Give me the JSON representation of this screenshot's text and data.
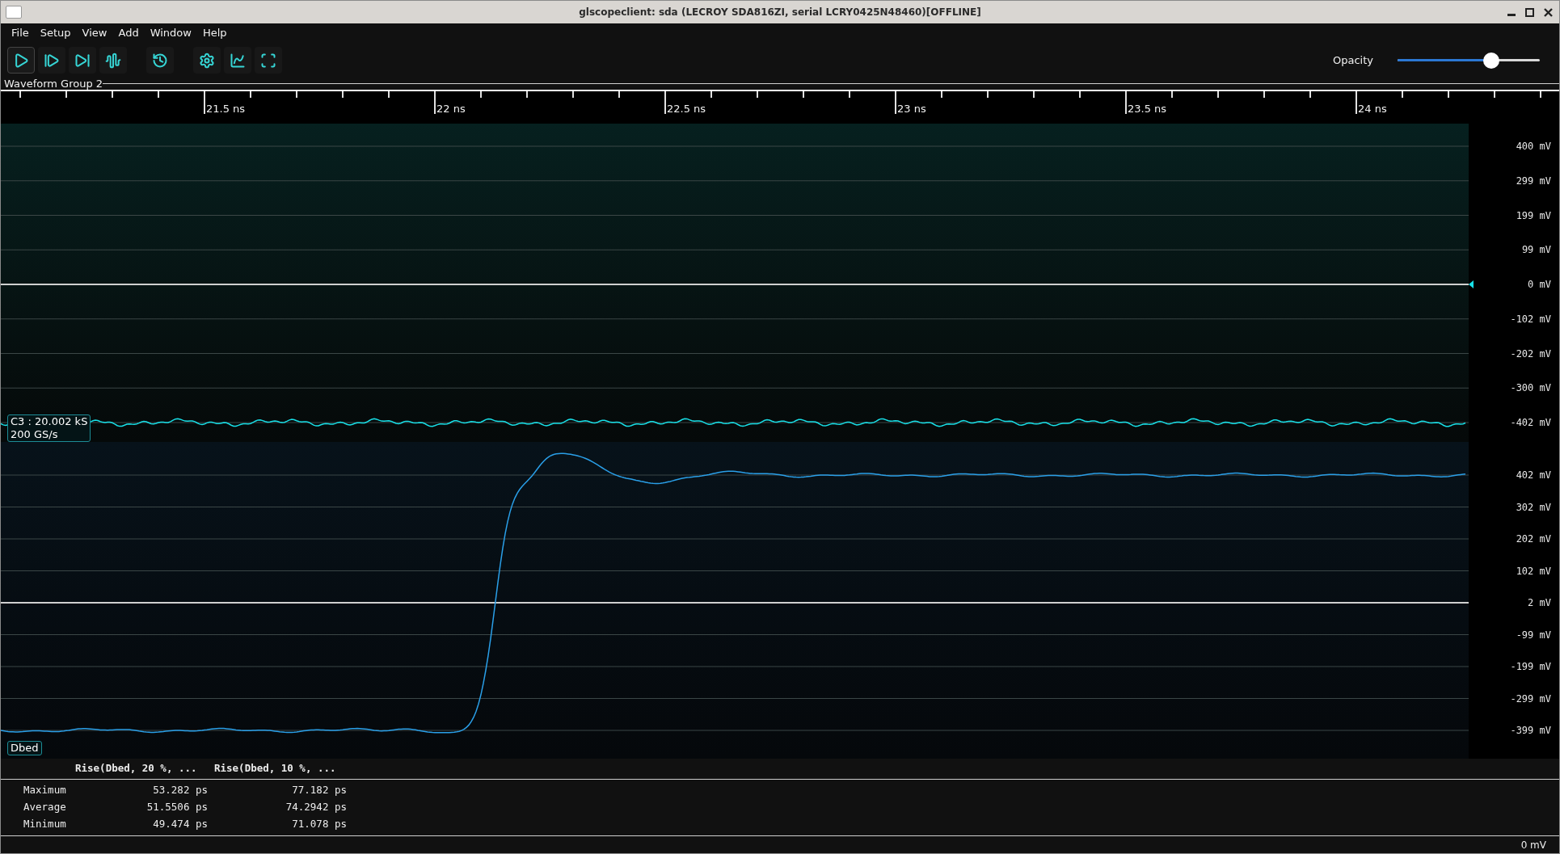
{
  "window": {
    "title": "glscopeclient: sda (LECROY SDA816ZI, serial LCRY0425N48460)[OFFLINE]"
  },
  "menu": [
    "File",
    "Setup",
    "View",
    "Add",
    "Window",
    "Help"
  ],
  "toolbar": [
    [
      {
        "kind": "start",
        "selected": true
      },
      {
        "kind": "single",
        "selected": false
      },
      {
        "kind": "force",
        "selected": false
      },
      {
        "kind": "stop",
        "selected": false
      }
    ],
    [
      {
        "kind": "history",
        "selected": false
      }
    ],
    [
      {
        "kind": "refresh",
        "selected": false
      },
      {
        "kind": "fit",
        "selected": false
      },
      {
        "kind": "fullscreen",
        "selected": false
      }
    ]
  ],
  "opacity": {
    "label": "Opacity",
    "level": 0.66
  },
  "group": {
    "title": "Waveform Group 2",
    "time_labels": [
      "21.5 ns",
      "22 ns",
      "22.5 ns",
      "23 ns",
      "23.5 ns",
      "24 ns"
    ]
  },
  "plots": [
    {
      "kind": "analog",
      "channel_lines": [
        "C3 : 20.002 kS",
        "200 GS/s"
      ],
      "y_labels": [
        "400 mV",
        "299 mV",
        "199 mV",
        "99 mV",
        "0 mV",
        "-102 mV",
        "-202 mV",
        "-300 mV",
        "-402 mV"
      ]
    },
    {
      "kind": "step",
      "channel_lines": [
        "Dbed"
      ],
      "y_labels": [
        "402 mV",
        "302 mV",
        "202 mV",
        "102 mV",
        "2 mV",
        "-99 mV",
        "-199 mV",
        "-299 mV",
        "-399 mV"
      ]
    }
  ],
  "measurements": {
    "columns": [
      "Rise(Dbed, 20 %, ...",
      "Rise(Dbed, 10 %, ..."
    ],
    "rows": [
      {
        "label": "Maximum",
        "values": [
          "53.282 ps",
          "77.182 ps"
        ]
      },
      {
        "label": "Average",
        "values": [
          "51.5506 ps",
          "74.2942 ps"
        ]
      },
      {
        "label": "Minimum",
        "values": [
          "49.474 ps",
          "71.078 ps"
        ]
      }
    ]
  },
  "status_bar": {
    "reading": "0 mV"
  }
}
